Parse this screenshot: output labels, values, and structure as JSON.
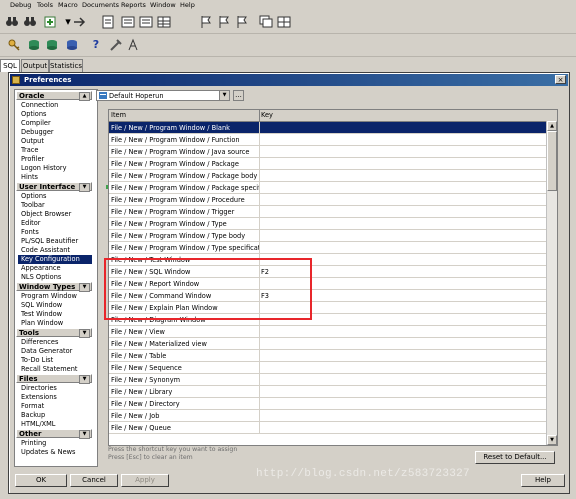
{
  "menubar": {
    "items": [
      "Debug",
      "Tools",
      "Macro",
      "Documents",
      "Reports",
      "Window",
      "Help"
    ]
  },
  "editor_tabs": [
    "SQL",
    "Output",
    "Statistics"
  ],
  "dialog": {
    "title": "Preferences",
    "close_glyph": "×",
    "nav": {
      "groups": [
        {
          "label": "Oracle",
          "items": [
            "Connection",
            "Options",
            "Compiler",
            "Debugger",
            "Output",
            "Trace",
            "Profiler",
            "Logon History",
            "Hints"
          ]
        },
        {
          "label": "User Interface",
          "items": [
            "Options",
            "Toolbar",
            "Object Browser",
            "Editor",
            "Fonts",
            "PL/SQL Beautifier",
            "Code Assistant",
            "Key Configuration",
            "Appearance",
            "NLS Options"
          ]
        },
        {
          "label": "Window Types",
          "items": [
            "Program Window",
            "SQL Window",
            "Test Window",
            "Plan Window"
          ]
        },
        {
          "label": "Tools",
          "items": [
            "Differences",
            "Data Generator",
            "To-Do List",
            "Recall Statement"
          ]
        },
        {
          "label": "Files",
          "items": [
            "Directories",
            "Extensions",
            "Format",
            "Backup",
            "HTML/XML"
          ]
        },
        {
          "label": "Other",
          "items": [
            "Printing",
            "Updates & News"
          ]
        }
      ],
      "selected": "Key Configuration"
    },
    "profile": {
      "value": "Default Hoperun",
      "ellipsis_label": "..."
    },
    "table": {
      "headers": [
        "Item",
        "Key"
      ],
      "rows": [
        {
          "item": "File / New / Program Window / Blank",
          "key": ""
        },
        {
          "item": "File / New / Program Window / Function",
          "key": ""
        },
        {
          "item": "File / New / Program Window / Java source",
          "key": ""
        },
        {
          "item": "File / New / Program Window / Package",
          "key": ""
        },
        {
          "item": "File / New / Program Window / Package body",
          "key": ""
        },
        {
          "item": "File / New / Program Window / Package specification",
          "key": ""
        },
        {
          "item": "File / New / Program Window / Procedure",
          "key": ""
        },
        {
          "item": "File / New / Program Window / Trigger",
          "key": ""
        },
        {
          "item": "File / New / Program Window / Type",
          "key": ""
        },
        {
          "item": "File / New / Program Window / Type body",
          "key": ""
        },
        {
          "item": "File / New / Program Window / Type specification",
          "key": ""
        },
        {
          "item": "File / New / Test Window",
          "key": ""
        },
        {
          "item": "File / New / SQL Window",
          "key": "F2"
        },
        {
          "item": "File / New / Report Window",
          "key": ""
        },
        {
          "item": "File / New / Command Window",
          "key": "F3"
        },
        {
          "item": "File / New / Explain Plan Window",
          "key": ""
        },
        {
          "item": "File / New / Diagram Window",
          "key": ""
        },
        {
          "item": "File / New / View",
          "key": ""
        },
        {
          "item": "File / New / Materialized view",
          "key": ""
        },
        {
          "item": "File / New / Table",
          "key": ""
        },
        {
          "item": "File / New / Sequence",
          "key": ""
        },
        {
          "item": "File / New / Synonym",
          "key": ""
        },
        {
          "item": "File / New / Library",
          "key": ""
        },
        {
          "item": "File / New / Directory",
          "key": ""
        },
        {
          "item": "File / New / Job",
          "key": ""
        },
        {
          "item": "File / New / Queue",
          "key": ""
        }
      ],
      "selected_row": 0
    },
    "hint_lines": [
      "Press the shortcut key you want to assign",
      "Press [Esc] to clear an item"
    ],
    "buttons": {
      "reset": "Reset to Default...",
      "ok": "OK",
      "cancel": "Cancel",
      "apply": "Apply",
      "help": "Help"
    }
  },
  "watermark": "http://blog.csdn.net/z583723327",
  "colors": {
    "title_gradient_start": "#0a246a",
    "title_gradient_end": "#3a6ea5",
    "selection": "#0a246a",
    "highlight_box": "#e8262b",
    "chrome": "#d4d0c8"
  },
  "icons": [
    "binoculars-icon",
    "new-icon",
    "compile-icon",
    "execute-icon",
    "help-icon",
    "key-icon",
    "window-icon"
  ]
}
